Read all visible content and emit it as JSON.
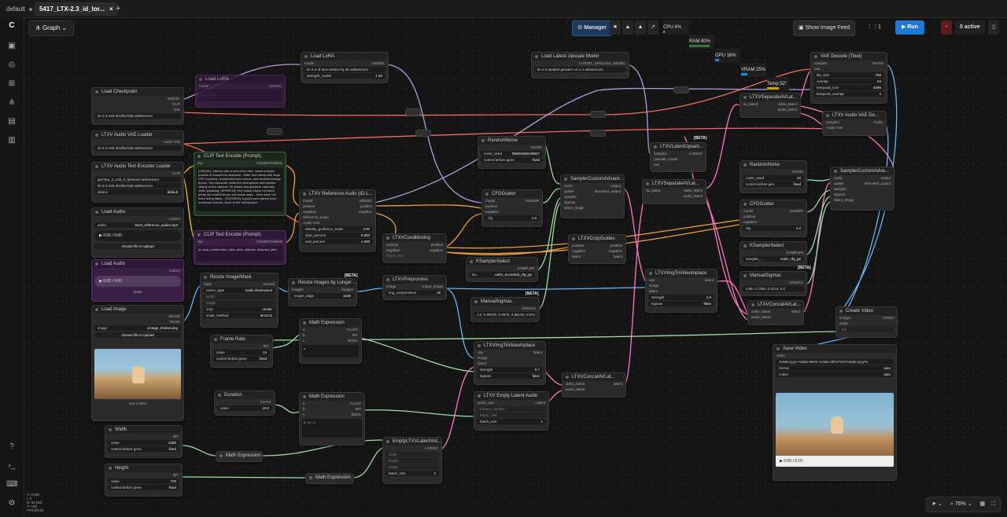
{
  "tabs": [
    {
      "label": "default"
    },
    {
      "label": "5417_LTX-2.3_id_lor..."
    }
  ],
  "toolbar": {
    "graph_label": "Graph",
    "manager_label": "Manager",
    "cpu_label": "CPU",
    "cpu_value": "4%",
    "ram_label": "RAM",
    "ram_value": "80%",
    "gpu_label": "GPU",
    "gpu_value": "16%",
    "vram_label": "VRAM",
    "vram_value": "25%",
    "temp_label": "Temp",
    "temp_value": "52°",
    "show_feed_label": "Show Image Feed",
    "queue_count": "1",
    "run_label": "Run",
    "active_label": "0 active",
    "zoom_value": "76%"
  },
  "stats": [
    "V: 0.00x",
    "I: 0",
    "N: 84 [84]",
    "V: 158",
    "FPS:59.52"
  ],
  "nodes": {
    "load_checkpoint": {
      "title": "Load Checkpoint",
      "out_model": "MODEL",
      "out_clip": "CLIP",
      "out_vae": "VAE",
      "ckpt": "ltx-2.3-22b-distilled-fp8.safetensors"
    },
    "load_lora_muted": {
      "title": "Load LoRA",
      "model": "model",
      "out_model": "MODEL"
    },
    "load_lora": {
      "title": "Load LoRA",
      "model": "model",
      "out_model": "MODEL",
      "lora": "ltx-2.3-id-lora-celebv-hq-3k.safetensors",
      "strength_label": "strength_model",
      "strength": "1.00"
    },
    "audio_vae_loader": {
      "title": "LTXV Audio VAE Loader",
      "out": "Audio VAE",
      "ckpt": "ltx-2.3-22b-distilled-fp8.safetensors"
    },
    "audio_text_encoder": {
      "title": "LTXV Audio Text Encoder Loader",
      "out": "CLIP",
      "text_encoder": "gemma_3_12B_it_fpmixed.safetensors",
      "ckpt": "ltx-2.3-22b-distilled-fp8.safetensors",
      "device_label": "device",
      "device": "default"
    },
    "clip_pos": {
      "title": "CLIP Text Encode (Prompt)",
      "clip": "clip",
      "out": "CONDITIONING",
      "text": "[VISUAL]: Interior with a retro-tech vibe; camera slowly pushes in toward the character. Older tech setup with large CRT monitors, a keyboard and mouse, and several storage boxes. The character holds the microphone and speaks clearly to the camera. He points and gestures naturally while speaking. [SPEECH]: Hey buddy, lately I've been pretty into stuff that you see these days... from what I've been doing lately... [SOUNDS]: A joyful and upbeat tone, moderate volume, close to the microphone."
    },
    "clip_neg": {
      "title": "CLIP Text Encode (Prompt)",
      "clip": "clip",
      "out": "CONDITIONING",
      "text": "pc beta, control slab, video beta, artifacts, distorted, jitter"
    },
    "load_audio": {
      "title": "Load Audio",
      "out": "AUDIO",
      "file_label": "audio",
      "file": "ltx23_reference_audio.mp3",
      "time": "0:00 / 0:00",
      "upload": "choose file to upload"
    },
    "load_audio_muted": {
      "title": "Load Audio",
      "out": "AUDIO",
      "time": "0:00 / 0:00",
      "file_label": "audio"
    },
    "load_image": {
      "title": "Load Image",
      "out_image": "IMAGE",
      "out_mask": "MASK",
      "file_label": "image",
      "file": "vintage_thinker.png",
      "upload": "choose file to upload",
      "dims": "512 x 1024"
    },
    "ref_audio": {
      "title": "LTXV Reference Audio (ID-L...",
      "ins": [
        "model",
        "positive",
        "negative",
        "reference_audio",
        "Audio VAE"
      ],
      "outs": [
        "MODEL",
        "positive",
        "negative"
      ],
      "w1l": "identity_guidance_scale",
      "w1": "3.00",
      "w2l": "start_percent",
      "w2": "0.000",
      "w3l": "end_percent",
      "w3": "1.000"
    },
    "random_noise1": {
      "title": "RandomNoise",
      "out": "NOISE",
      "seed_label": "noise_seed",
      "seed": "95804058249827",
      "ctrl_label": "control before gene",
      "ctrl": "fixed"
    },
    "cfg_guider1": {
      "title": "CFGGuider",
      "ins": [
        "model",
        "positive",
        "negative"
      ],
      "out": "GUIDER",
      "cfg_label": "cfg",
      "cfg": "1.0"
    },
    "sampler_adv1": {
      "title": "SamplerCustomAdvanc...",
      "ins": [
        "noise",
        "guider",
        "sampler",
        "sigmas",
        "latent_image"
      ],
      "outs": [
        "output",
        "denoised_output"
      ]
    },
    "ltxv_cond": {
      "title": "LTXVConditioning",
      "ins": [
        "positive",
        "negative"
      ],
      "outs": [
        "positive",
        "negative"
      ],
      "fr_label": "frame_rate"
    },
    "ksampler_select1": {
      "title": "KSamplerSelect",
      "out": "SAMPLER",
      "name_label": "sa...",
      "name": "euler_ancestral_cfg_pp"
    },
    "manual_sigmas1": {
      "title": "ManualSigmas",
      "out": "SIGMAS",
      "sigmas": "1.0, 0.99375, 0.9875, 0.98125, 0.975, 0.909375, 0.725, 0.421875, 0.0"
    },
    "crop_guides": {
      "title": "LTXVCropGuides",
      "ins": [
        "positive",
        "negative",
        "latent"
      ],
      "outs": [
        "positive",
        "negative",
        "latent"
      ]
    },
    "resize_mask": {
      "title": "Resize Image/Mask",
      "in": "input",
      "out": "resized",
      "w1l": "resize_type",
      "w1": "scale dimensions",
      "w2l": "width",
      "w3l": "height",
      "w4l": "crop",
      "w4": "center",
      "w5l": "scale_method",
      "w5": "lanczos"
    },
    "resize_longer": {
      "title": "Resize Images by Longer ...",
      "in": "images",
      "out": "images",
      "w_label": "longer_edge",
      "w": "1536"
    },
    "ltxv_preprocess": {
      "title": "LTXVPreprocess",
      "in": "image",
      "out": "output_image",
      "w_label": "img_compression",
      "w": "18"
    },
    "math1": {
      "title": "Math Expression",
      "ins": [
        "a",
        "b",
        "c"
      ],
      "outs": [
        "FLOAT",
        "INT",
        "BOOL"
      ],
      "expr": "a"
    },
    "frame_rate": {
      "title": "Frame Rate",
      "out": "INT",
      "w1l": "value",
      "w1": "24",
      "w2l": "control before gene",
      "w2": "fixed"
    },
    "duration": {
      "title": "Duration",
      "out": "FLOAT",
      "w1l": "value",
      "w1": "10.0"
    },
    "math2": {
      "title": "Math Expression",
      "ins": [
        "a",
        "b",
        "c"
      ],
      "outs": [
        "FLOAT",
        "INT",
        "BOOL"
      ],
      "expr": "a * b + 1"
    },
    "img_to_video": {
      "title": "LTXVImgToVideoInplace",
      "ins": [
        "vae",
        "image",
        "latent"
      ],
      "out": "latent",
      "w1l": "strength",
      "w1": "0.7",
      "w2l": "bypass",
      "w2": "false"
    },
    "concat1": {
      "title": "LTXVConcatAVLat...",
      "ins": [
        "video_latent",
        "audio_latent"
      ],
      "out": "latent"
    },
    "empty_audio": {
      "title": "LTXV Empty Latent Audio",
      "ins": [
        "audio_vae",
        "frames_number",
        "frame_rate"
      ],
      "out": "Latent",
      "w1l": "batch_size",
      "w1": "1"
    },
    "empty_latent": {
      "title": "EmptyLTXVLatentVid...",
      "out": "LATENT",
      "ins": [
        "width",
        "height",
        "length"
      ],
      "w1l": "batch_size",
      "w1": "1"
    },
    "width": {
      "title": "Width",
      "out": "INT",
      "w1l": "value",
      "w1": "1280",
      "w2l": "control before gene",
      "w2": "fixed"
    },
    "height": {
      "title": "Height",
      "out": "INT",
      "w1l": "value",
      "w1": "720",
      "w2l": "control before gene",
      "w2": "fixed"
    },
    "math3": {
      "title": "Math Expression"
    },
    "math4": {
      "title": "Math Expression"
    },
    "upscale_model": {
      "title": "Load Latent Upscale Model",
      "out": "LATENT_UPSCALE_MODEL",
      "model": "ltx-2.3-spatial-upscaler-x2-1.1.safetensors"
    },
    "latent_upsample": {
      "title": "LTXVLatentUpsam...",
      "ins": [
        "samples",
        "upscale_model",
        "vae"
      ],
      "out": "LATENT"
    },
    "separate1": {
      "title": "LTXVSeparateAVLat...",
      "in": "av_latent",
      "outs": [
        "video_latent",
        "audio_latent"
      ]
    },
    "separate2": {
      "title": "LTXVSeparateAVLat...",
      "in": "av_latent",
      "outs": [
        "video_latent",
        "audio_latent"
      ]
    },
    "img_to_video2": {
      "title": "LTXVImgToVideoInplace",
      "ins": [
        "vae",
        "image",
        "latent"
      ],
      "out": "latent",
      "w1l": "strength",
      "w1": "1.0",
      "w2l": "bypass",
      "w2": "false"
    },
    "vae_tiled": {
      "title": "VAE Decode (Tiled)",
      "ins": [
        "samples",
        "vae"
      ],
      "out": "IMAGE",
      "w1l": "tile_size",
      "w1": "768",
      "w2l": "overlap",
      "w2": "64",
      "w3l": "temporal_size",
      "w3": "4096",
      "w4l": "temporal_overlap",
      "w4": "4"
    },
    "audio_vae_decode": {
      "title": "LTXV Audio VAE De...",
      "ins": [
        "samples",
        "Audio VAE"
      ],
      "out": "Audio"
    },
    "random_noise2": {
      "title": "RandomNoise",
      "out": "NOISE",
      "seed_label": "noise_seed",
      "seed": "42",
      "ctrl_label": "control before gen",
      "ctrl": "fixed"
    },
    "cfg_guider2": {
      "title": "CFGGuider",
      "ins": [
        "model",
        "positive",
        "negative"
      ],
      "out": "GUIDER",
      "cfg_label": "cfg",
      "cfg": "1.0"
    },
    "sampler_adv2": {
      "title": "SamplerCustomAdva...",
      "ins": [
        "noise",
        "guider",
        "sampler",
        "sigmas",
        "latent_image"
      ],
      "outs": [
        "output",
        "denoised_output"
      ]
    },
    "ksampler_select2": {
      "title": "KSamplerSelect",
      "out": "SAMPLER",
      "name_label": "sampler_...",
      "name": "euler_cfg_pp"
    },
    "manual_sigmas2": {
      "title": "ManualSigmas",
      "out": "SIGMAS",
      "sigmas": "0.85, 0.7250, 0.4219, 0.0"
    },
    "concat2": {
      "title": "LTXVConcatAVLat...",
      "ins": [
        "video_latent",
        "audio_latent"
      ],
      "out": "latent"
    },
    "create_video": {
      "title": "Create Video",
      "ins": [
        "images",
        "audio",
        "fps"
      ],
      "out": "VIDEO"
    },
    "save_video": {
      "title": "Save Video",
      "in": "video",
      "prefix": "%date:yyyy-%date:MM% %date:dd%/%RS%date:yyyy%-",
      "format_label": "format",
      "format": "auto",
      "codec_label": "codec",
      "codec": "auto",
      "time": "0:00 / 0:10"
    }
  },
  "beta_label": "[BETA]"
}
